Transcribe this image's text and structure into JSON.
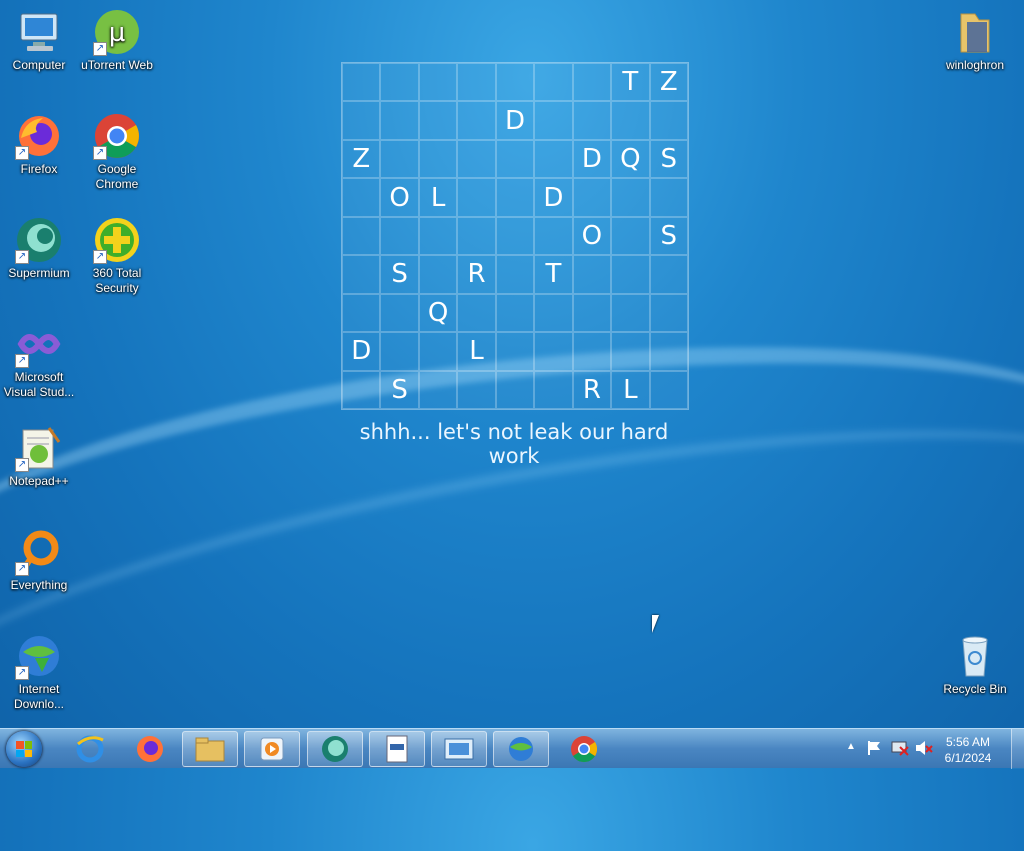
{
  "desktop": {
    "icons": [
      {
        "name": "computer-icon",
        "label": "Computer"
      },
      {
        "name": "utorrent-web-icon",
        "label": "uTorrent Web"
      },
      {
        "name": "firefox-icon",
        "label": "Firefox"
      },
      {
        "name": "google-chrome-icon",
        "label": "Google Chrome"
      },
      {
        "name": "supermium-icon",
        "label": "Supermium"
      },
      {
        "name": "360-total-security-icon",
        "label": "360 Total Security"
      },
      {
        "name": "visual-studio-icon",
        "label": "Microsoft Visual Stud..."
      },
      {
        "name": "notepad-plus-plus-icon",
        "label": "Notepad++"
      },
      {
        "name": "everything-icon",
        "label": "Everything"
      },
      {
        "name": "internet-download-manager-icon",
        "label": "Internet Downlo..."
      },
      {
        "name": "winloghron-folder-icon",
        "label": "winloghron"
      },
      {
        "name": "recycle-bin-icon",
        "label": "Recycle Bin"
      }
    ]
  },
  "widget": {
    "grid": [
      [
        "",
        "",
        "",
        "",
        "",
        "",
        "",
        "T",
        "Z"
      ],
      [
        "",
        "",
        "",
        "",
        "D",
        "",
        "",
        "",
        ""
      ],
      [
        "Z",
        "",
        "",
        "",
        "",
        "",
        "D",
        "Q",
        "S"
      ],
      [
        "",
        "O",
        "L",
        "",
        "",
        "D",
        "",
        "",
        ""
      ],
      [
        "",
        "",
        "",
        "",
        "",
        "",
        "O",
        "",
        "S"
      ],
      [
        "",
        "S",
        "",
        "R",
        "",
        "T",
        "",
        "",
        ""
      ],
      [
        "",
        "",
        "Q",
        "",
        "",
        "",
        "",
        "",
        ""
      ],
      [
        "D",
        "",
        "",
        "L",
        "",
        "",
        "",
        "",
        ""
      ],
      [
        "",
        "S",
        "",
        "",
        "",
        "",
        "R",
        "L",
        ""
      ]
    ],
    "caption": "shhh... let's not leak our hard work"
  },
  "taskbar": {
    "clock_time": "5:56 AM",
    "clock_date": "6/1/2024",
    "pinned": [
      "internet-explorer-icon",
      "firefox-icon",
      "file-explorer-icon",
      "media-player-icon",
      "supermium-icon",
      "notepad-icon",
      "photo-viewer-icon",
      "internet-download-manager-icon",
      "google-chrome-icon"
    ]
  }
}
